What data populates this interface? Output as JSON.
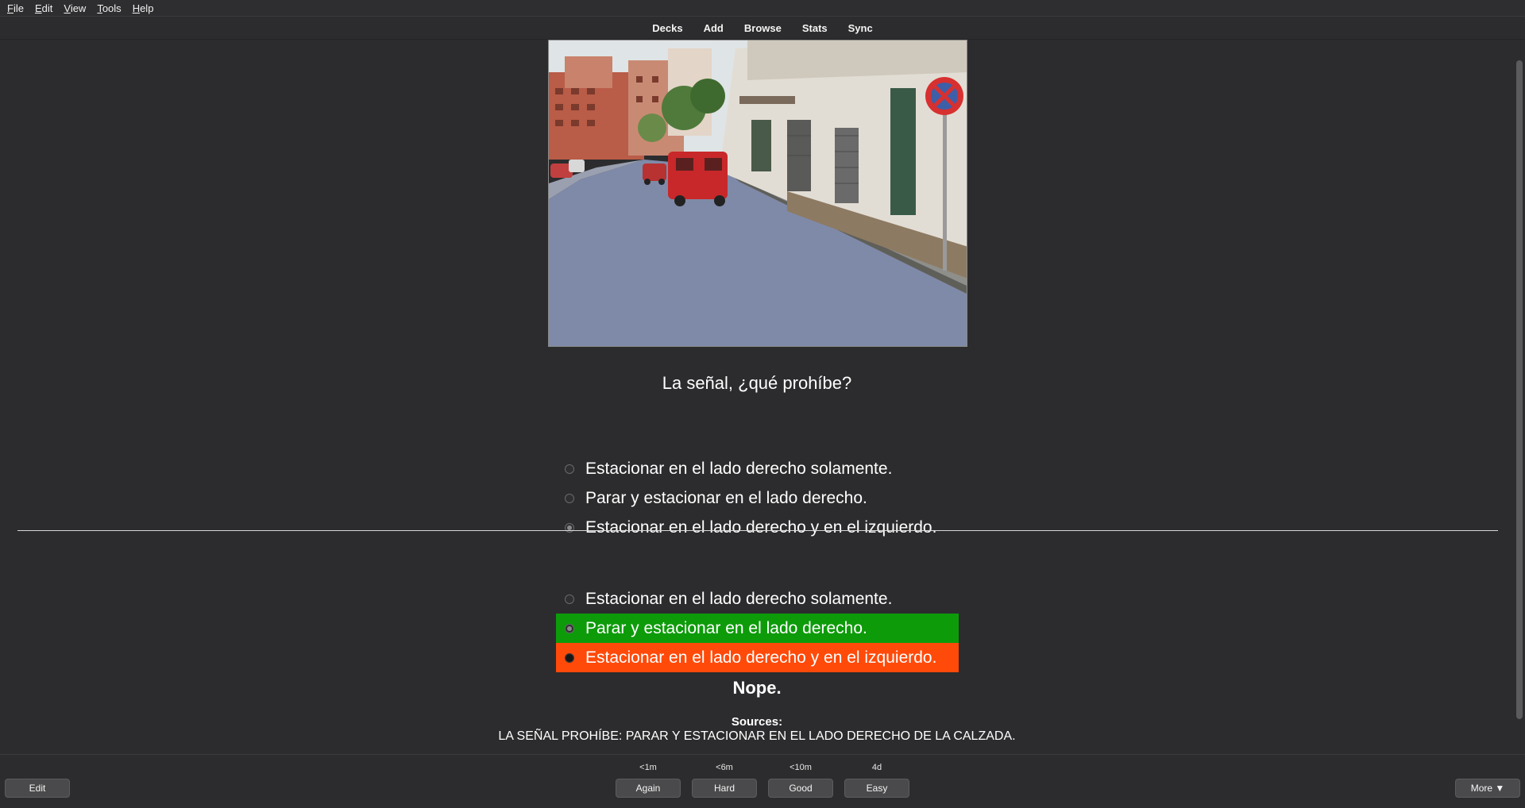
{
  "menu": {
    "items": [
      {
        "key": "F",
        "rest": "ile"
      },
      {
        "key": "E",
        "rest": "dit"
      },
      {
        "key": "V",
        "rest": "iew"
      },
      {
        "key": "T",
        "rest": "ools"
      },
      {
        "key": "H",
        "rest": "elp"
      }
    ]
  },
  "toolbar": {
    "decks": "Decks",
    "add": "Add",
    "browse": "Browse",
    "stats": "Stats",
    "sync": "Sync"
  },
  "card": {
    "question": "La señal, ¿qué prohíbe?",
    "question_options": [
      {
        "text": "Estacionar en el lado derecho solamente.",
        "selected": false
      },
      {
        "text": "Parar y estacionar en el lado derecho.",
        "selected": false
      },
      {
        "text": "Estacionar en el lado derecho y en el izquierdo.",
        "selected": true
      }
    ],
    "answer_options": [
      {
        "text": "Estacionar en el lado derecho solamente.",
        "state": "neutral"
      },
      {
        "text": "Parar y estacionar en el lado derecho.",
        "state": "correct"
      },
      {
        "text": "Estacionar en el lado derecho y en el izquierdo.",
        "state": "wrong"
      }
    ],
    "verdict": "Nope.",
    "sources_title": "Sources:",
    "sources_text": "LA SEÑAL PROHÍBE: PARAR Y ESTACIONAR EN EL LADO DERECHO DE LA CALZADA."
  },
  "bottom": {
    "edit": "Edit",
    "more": "More ▼",
    "answers": [
      {
        "label": "Again",
        "interval": "<1m"
      },
      {
        "label": "Hard",
        "interval": "<6m"
      },
      {
        "label": "Good",
        "interval": "<10m"
      },
      {
        "label": "Easy",
        "interval": "4d"
      }
    ]
  },
  "colors": {
    "background": "#2c2c2e",
    "correct": "#0d9b0a",
    "wrong": "#ff4a0a"
  }
}
